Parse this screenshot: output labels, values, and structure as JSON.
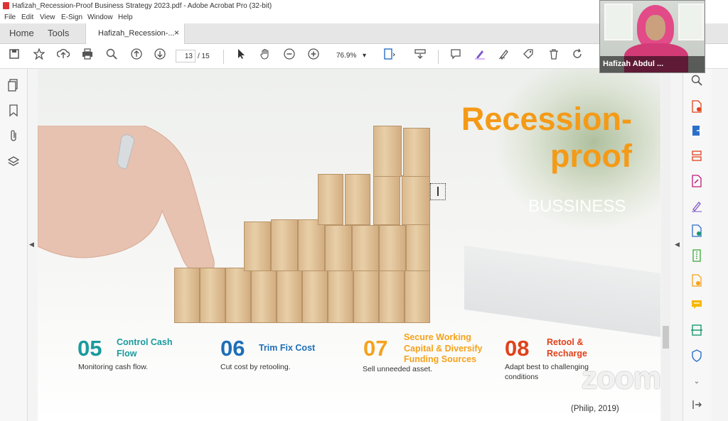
{
  "window": {
    "title": "Hafizah_Recession-Proof Business Strategy 2023.pdf - Adobe Acrobat Pro (32-bit)"
  },
  "menu": [
    "File",
    "Edit",
    "View",
    "E-Sign",
    "Window",
    "Help"
  ],
  "tabs": {
    "home": "Home",
    "tools": "Tools",
    "document": "Hafizah_Recession-...",
    "close": "×"
  },
  "toolbar": {
    "page_current": "13",
    "page_total": "/ 15",
    "zoom": "76.9%",
    "zoom_arrow": "▾"
  },
  "slide": {
    "title_line1": "Recession-",
    "title_line2": "proof",
    "subtitle": "BUSSINESS",
    "items": [
      {
        "num": "05",
        "heading_line1": "Control Cash",
        "heading_line2": "Flow",
        "heading_line3": "",
        "desc_line1": "Monitoring cash flow.",
        "desc_line2": "",
        "color": "#1a9a9e"
      },
      {
        "num": "06",
        "heading_line1": "Trim Fix Cost",
        "heading_line2": "",
        "heading_line3": "",
        "desc_line1": "Cut cost by retooling.",
        "desc_line2": "",
        "color": "#1d6fb8"
      },
      {
        "num": "07",
        "heading_line1": "Secure Working",
        "heading_line2": "Capital & Diversify",
        "heading_line3": "Funding Sources",
        "desc_line1": "Sell unneeded asset.",
        "desc_line2": "",
        "color": "#f5a21b"
      },
      {
        "num": "08",
        "heading_line1": "Retool &",
        "heading_line2": "Recharge",
        "heading_line3": "",
        "desc_line1": "Adapt best to challenging",
        "desc_line2": "conditions",
        "color": "#e0421b"
      }
    ],
    "citation": "(Philip, 2019)"
  },
  "webcam": {
    "participant_name": "Hafizah Abdul ..."
  },
  "watermark": "zoom",
  "colors": {
    "title_orange": "#f49a17"
  }
}
